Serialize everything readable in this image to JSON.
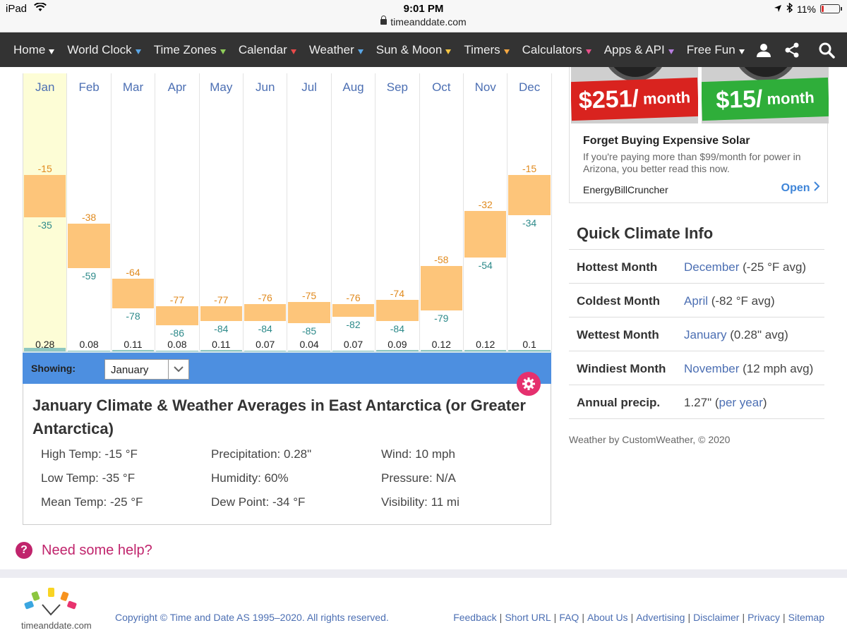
{
  "status_bar": {
    "device": "iPad",
    "time": "9:01 PM",
    "url": "timeanddate.com",
    "battery": "11%",
    "battery_level": 0.11
  },
  "nav": {
    "items": [
      {
        "label": "Home",
        "caret_color": "#ffffff"
      },
      {
        "label": "World Clock",
        "caret_color": "#5aa6e6"
      },
      {
        "label": "Time Zones",
        "caret_color": "#8fce5a"
      },
      {
        "label": "Calendar",
        "caret_color": "#e84a4a"
      },
      {
        "label": "Weather",
        "caret_color": "#5aa6e6"
      },
      {
        "label": "Sun & Moon",
        "caret_color": "#f4c542"
      },
      {
        "label": "Timers",
        "caret_color": "#f4a742"
      },
      {
        "label": "Calculators",
        "caret_color": "#e8508a"
      },
      {
        "label": "Apps & API",
        "caret_color": "#b77ee0"
      },
      {
        "label": "Free Fun",
        "caret_color": "#ffffff"
      }
    ],
    "icons": [
      "user-icon",
      "share-icon",
      "search-icon"
    ]
  },
  "chart_data": {
    "type": "bar",
    "categories": [
      "Jan",
      "Feb",
      "Mar",
      "Apr",
      "May",
      "Jun",
      "Jul",
      "Aug",
      "Sep",
      "Oct",
      "Nov",
      "Dec"
    ],
    "series": [
      {
        "values": [
          -15,
          -38,
          -64,
          -77,
          -77,
          -76,
          -75,
          -76,
          -74,
          -58,
          -32,
          -15
        ]
      },
      {
        "values": [
          -35,
          -59,
          -78,
          -86,
          -84,
          -84,
          -85,
          -82,
          -84,
          -79,
          -54,
          -34
        ]
      },
      {
        "values": [
          0.28,
          0.08,
          0.11,
          0.08,
          0.11,
          0.07,
          0.04,
          0.07,
          0.09,
          0.12,
          0.12,
          0.1
        ]
      }
    ],
    "precip_labels": [
      "0.28",
      "0.08",
      "0.11",
      "0.08",
      "0.11",
      "0.07",
      "0.04",
      "0.07",
      "0.09",
      "0.12",
      "0.12",
      "0.1"
    ],
    "ylim": [
      -90,
      -15
    ],
    "selected": "Jan",
    "colors": {
      "bar": "#fdc57a",
      "high": "#e08a1e",
      "low": "#2d8a8a",
      "selected_bg": "#fdfdd6",
      "precip": "#8fc7c0"
    }
  },
  "showing": {
    "label": "Showing:",
    "selected_month": "January"
  },
  "details": {
    "title": "January Climate & Weather Averages in East Antarctica (or Greater Antarctica)",
    "stats": [
      {
        "label": "High Temp:",
        "value": "-15 °F"
      },
      {
        "label": "Low Temp:",
        "value": "-35 °F"
      },
      {
        "label": "Mean Temp:",
        "value": "-25 °F"
      },
      {
        "label": "Precipitation:",
        "value": "0.28\""
      },
      {
        "label": "Humidity:",
        "value": "60%"
      },
      {
        "label": "Dew Point:",
        "value": "-34 °F"
      },
      {
        "label": "Wind:",
        "value": "10 mph"
      },
      {
        "label": "Pressure:",
        "value": "N/A"
      },
      {
        "label": "Visibility:",
        "value": "11 mi"
      }
    ]
  },
  "help": {
    "label": "Need some help?"
  },
  "ad": {
    "price_left": "$251/",
    "price_left_unit": "month",
    "price_right": "$15/",
    "price_right_unit": "month",
    "title": "Forget Buying Expensive Solar",
    "text": "If you're paying more than $99/month for power in Arizona, you better read this now.",
    "brand": "EnergyBillCruncher",
    "cta": "Open",
    "colors": {
      "left": "#d9231f",
      "right": "#2fae3a"
    }
  },
  "quick_climate": {
    "title": "Quick Climate Info",
    "rows": [
      {
        "label": "Hottest Month",
        "link": "December",
        "rest": " (-25 °F avg)"
      },
      {
        "label": "Coldest Month",
        "link": "April",
        "rest": " (-82 °F avg)"
      },
      {
        "label": "Wettest Month",
        "link": "January",
        "rest": " (0.28\" avg)"
      },
      {
        "label": "Windiest Month",
        "link": "November",
        "rest": " (12 mph avg)"
      },
      {
        "label": "Annual precip.",
        "pre": "1.27\" (",
        "link": "per year",
        "rest": ")"
      }
    ],
    "credit": "Weather by CustomWeather, © 2020"
  },
  "footer": {
    "logo_text": "timeanddate.com",
    "copyright": "Copyright © Time and Date AS 1995–2020. All rights reserved.",
    "links": [
      "Feedback",
      "Short URL",
      "FAQ",
      "About Us",
      "Advertising",
      "Disclaimer",
      "Privacy",
      "Sitemap"
    ]
  }
}
